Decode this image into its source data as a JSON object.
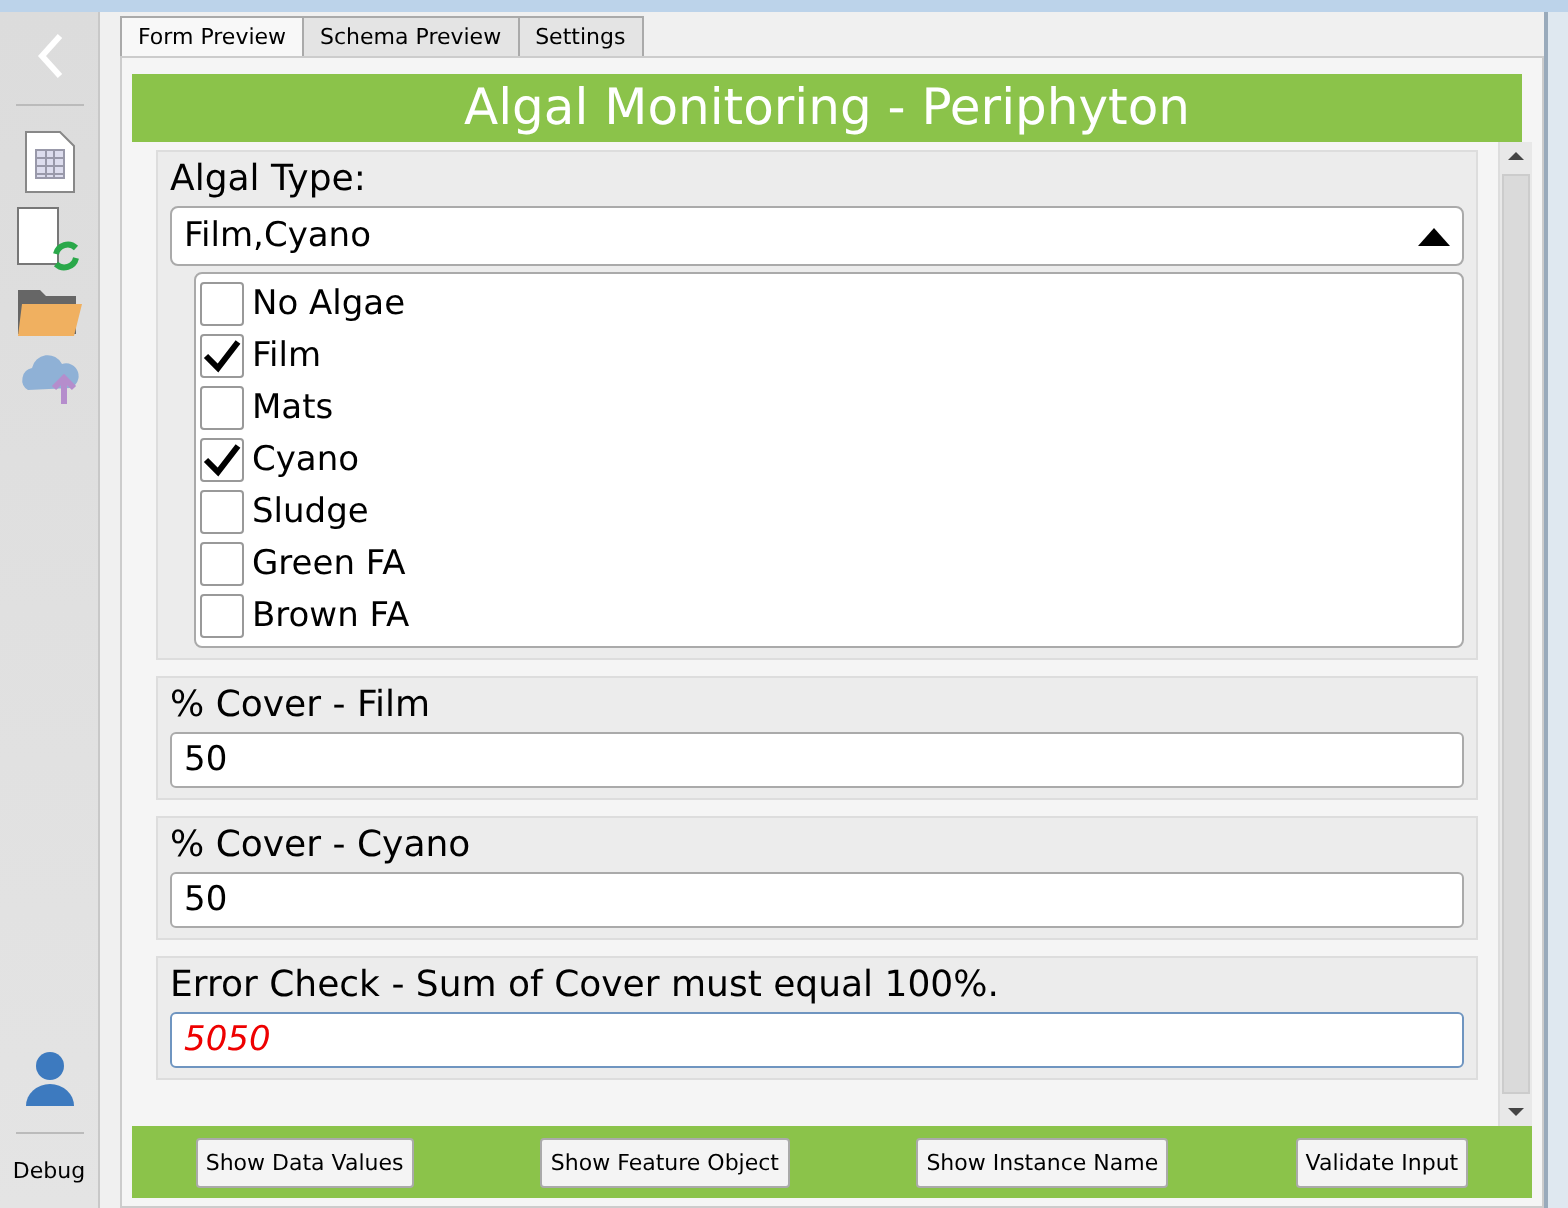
{
  "sidebar": {
    "debug_label": "Debug"
  },
  "tabs": [
    {
      "label": "Form Preview",
      "selected": true
    },
    {
      "label": "Schema Preview",
      "selected": false
    },
    {
      "label": "Settings",
      "selected": false
    }
  ],
  "banner": {
    "title": "Algal Monitoring - Periphyton"
  },
  "algal_type": {
    "label": "Algal Type:",
    "value": "Film,Cyano",
    "expanded": true,
    "options": [
      {
        "label": "No Algae",
        "checked": false
      },
      {
        "label": "Film",
        "checked": true
      },
      {
        "label": "Mats",
        "checked": false
      },
      {
        "label": "Cyano",
        "checked": true
      },
      {
        "label": "Sludge",
        "checked": false
      },
      {
        "label": "Green FA",
        "checked": false
      },
      {
        "label": "Brown FA",
        "checked": false
      }
    ]
  },
  "fields": [
    {
      "label": "% Cover - Film",
      "value": "50",
      "error": false
    },
    {
      "label": "% Cover - Cyano",
      "value": "50",
      "error": false
    },
    {
      "label": "Error Check - Sum of Cover must equal 100%.",
      "value": "5050",
      "error": true
    }
  ],
  "buttons": [
    "Show Data Values",
    "Show Feature Object",
    "Show Instance Name",
    "Validate Input"
  ]
}
